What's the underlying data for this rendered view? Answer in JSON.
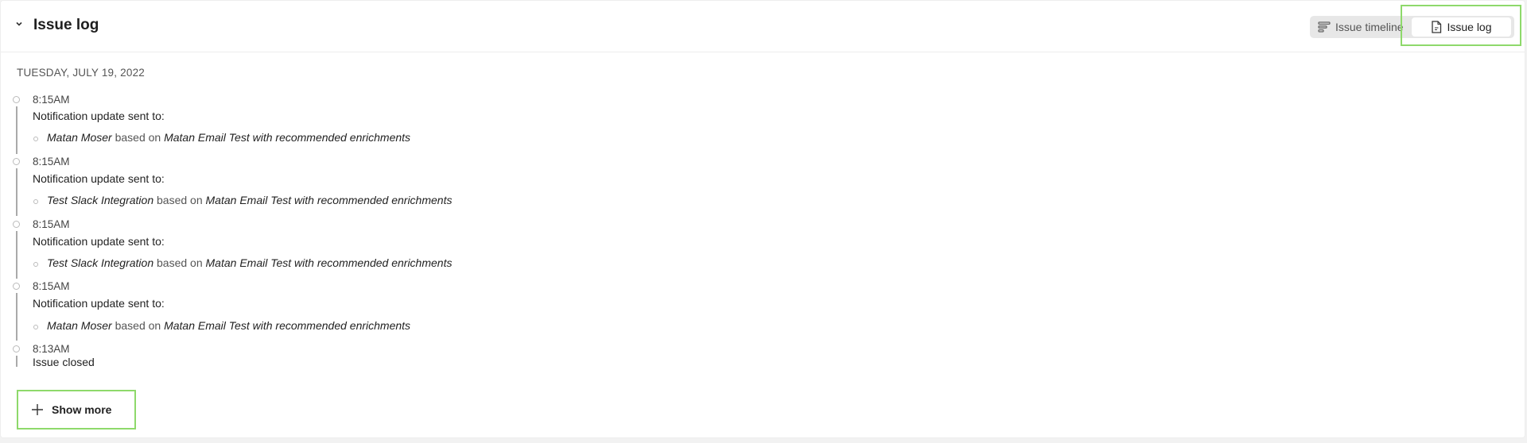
{
  "header": {
    "title": "Issue log",
    "collapse_icon": "chevron-down-icon"
  },
  "view_toggle": {
    "options": [
      {
        "label": "Issue timeline",
        "icon": "timeline-icon",
        "selected": false
      },
      {
        "label": "Issue log",
        "icon": "document-icon",
        "selected": true
      }
    ]
  },
  "log": {
    "date": "TUESDAY, JULY 19, 2022",
    "entries": [
      {
        "time": "8:15AM",
        "message": "Notification update sent to:",
        "recipient": "Matan Moser",
        "connector": "based on",
        "rule": "Matan Email Test with recommended enrichments"
      },
      {
        "time": "8:15AM",
        "message": "Notification update sent to:",
        "recipient": "Test Slack Integration",
        "connector": "based on",
        "rule": "Matan Email Test with recommended enrichments"
      },
      {
        "time": "8:15AM",
        "message": "Notification update sent to:",
        "recipient": "Test Slack Integration",
        "connector": "based on",
        "rule": "Matan Email Test with recommended enrichments"
      },
      {
        "time": "8:15AM",
        "message": "Notification update sent to:",
        "recipient": "Matan Moser",
        "connector": "based on",
        "rule": "Matan Email Test with recommended enrichments"
      },
      {
        "time": "8:13AM",
        "message": "Issue closed"
      }
    ]
  },
  "show_more": {
    "label": "Show more",
    "icon": "plus-icon"
  },
  "colors": {
    "highlight": "#8ed96b",
    "timeline_line": "#aaaaaa"
  }
}
